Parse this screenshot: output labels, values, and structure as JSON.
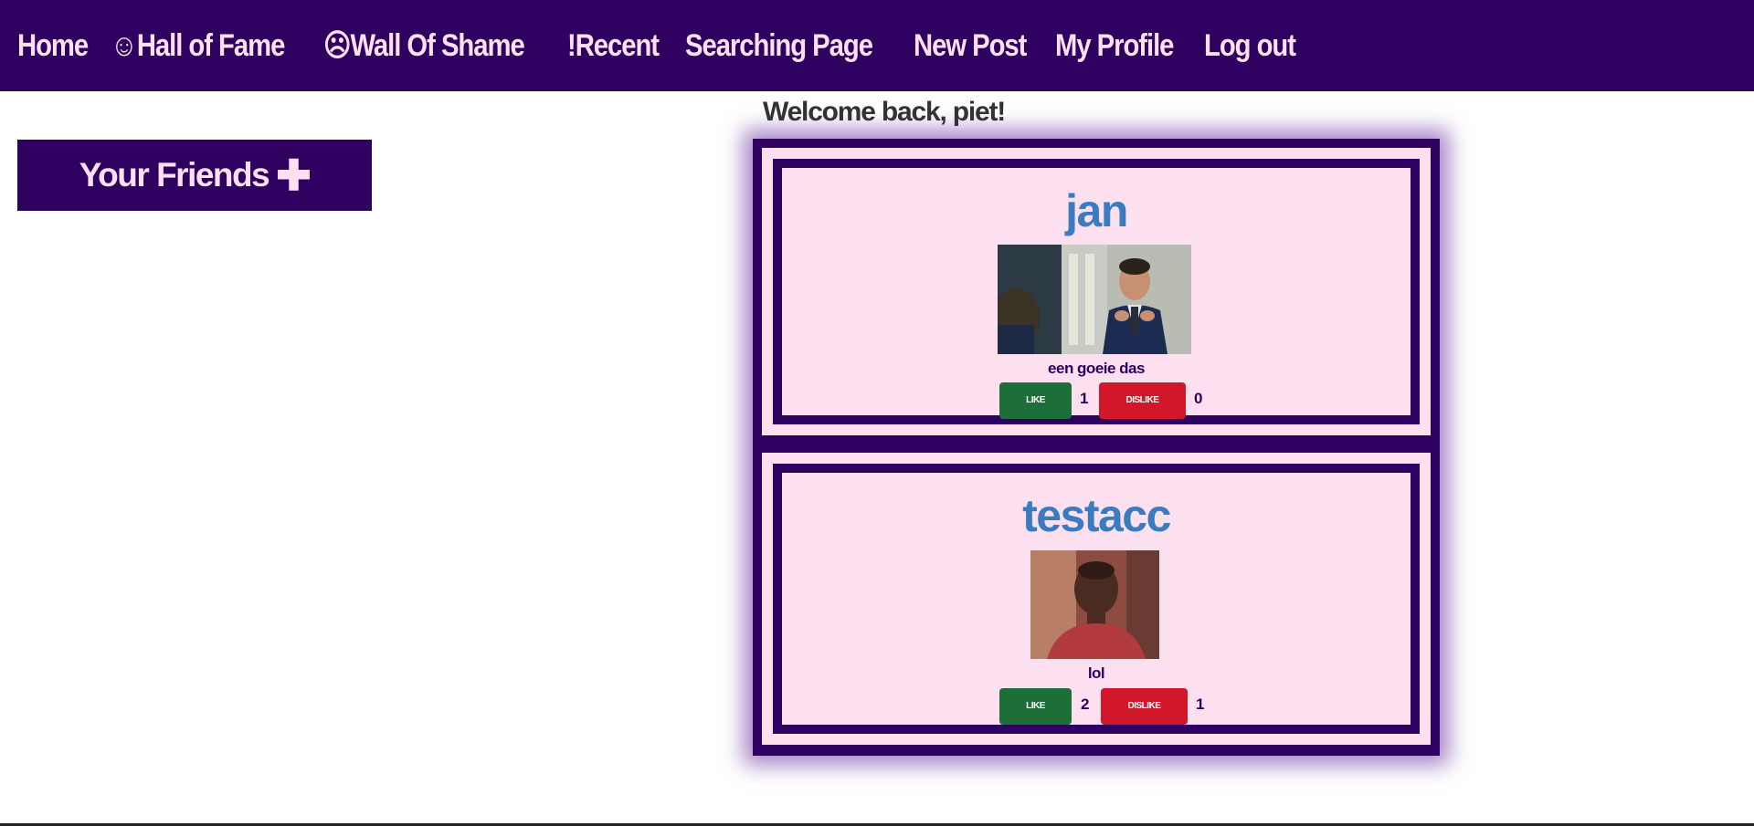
{
  "nav": {
    "items": [
      {
        "label": "Home"
      },
      {
        "label": "☺Hall of Fame"
      },
      {
        "label": "☹Wall Of Shame"
      },
      {
        "label": "!Recent"
      },
      {
        "label": "Searching Page"
      },
      {
        "label": "New Post"
      },
      {
        "label": "My Profile"
      },
      {
        "label": "Log out"
      }
    ]
  },
  "sidebar": {
    "friends_label": "Your Friends",
    "friends_icon": "✚"
  },
  "welcome": "Welcome back, piet!",
  "posts": [
    {
      "user": "jan",
      "caption": "een goeie das",
      "like_label": "LIKE",
      "likes": "1",
      "dislike_label": "DISLIKE",
      "dislikes": "0"
    },
    {
      "user": "testacc",
      "caption": "lol",
      "like_label": "LIKE",
      "likes": "2",
      "dislike_label": "DISLIKE",
      "dislikes": "1"
    }
  ],
  "colors": {
    "nav_bg": "#2e0060",
    "nav_text": "#fde0ef",
    "post_bg": "#fde0ef",
    "username": "#3a7cbf",
    "like": "#1e6e3a",
    "dislike": "#d3172a"
  }
}
